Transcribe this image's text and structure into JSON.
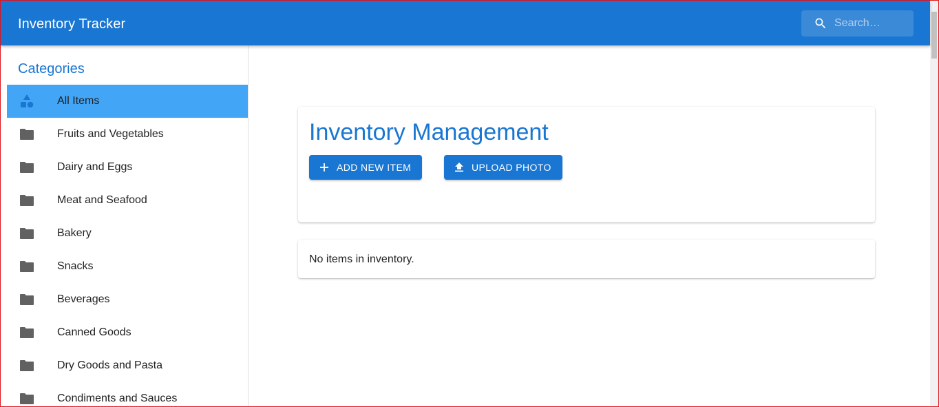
{
  "appbar": {
    "title": "Inventory Tracker",
    "search": {
      "placeholder": "Search…",
      "value": "",
      "icon": "search-icon"
    }
  },
  "sidebar": {
    "heading": "Categories",
    "items": [
      {
        "label": "All Items",
        "icon": "category-shapes-icon",
        "selected": true
      },
      {
        "label": "Fruits and Vegetables",
        "icon": "folder-icon"
      },
      {
        "label": "Dairy and Eggs",
        "icon": "folder-icon"
      },
      {
        "label": "Meat and Seafood",
        "icon": "folder-icon"
      },
      {
        "label": "Bakery",
        "icon": "folder-icon"
      },
      {
        "label": "Snacks",
        "icon": "folder-icon"
      },
      {
        "label": "Beverages",
        "icon": "folder-icon"
      },
      {
        "label": "Canned Goods",
        "icon": "folder-icon"
      },
      {
        "label": "Dry Goods and Pasta",
        "icon": "folder-icon"
      },
      {
        "label": "Condiments and Sauces",
        "icon": "folder-icon"
      }
    ]
  },
  "main": {
    "title": "Inventory Management",
    "buttons": {
      "add_label": "ADD NEW ITEM",
      "add_icon": "plus-icon",
      "upload_label": "UPLOAD PHOTO",
      "upload_icon": "upload-icon"
    },
    "empty_message": "No items in inventory."
  },
  "colors": {
    "primary": "#1976d2",
    "selected": "#42a5f5",
    "icon_gray": "#616161",
    "text": "#212121"
  }
}
